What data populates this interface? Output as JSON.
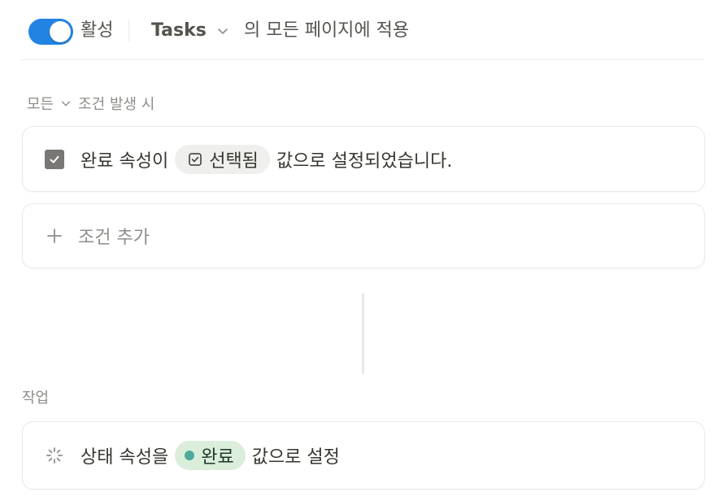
{
  "header": {
    "toggle_on": true,
    "active_label": "활성",
    "database_name": "Tasks",
    "apply_text": "의 모든 페이지에 적용"
  },
  "trigger": {
    "mode": "모든",
    "label_suffix": "조건 발생 시",
    "condition": {
      "prefix": "완료 속성이",
      "value_pill": "선택됨",
      "suffix": "값으로 설정되었습니다."
    },
    "add_condition_label": "조건 추가"
  },
  "actions": {
    "section_label": "작업",
    "items": [
      {
        "prefix": "상태 속성을",
        "value_pill": "완료",
        "suffix": "값으로 설정"
      }
    ]
  },
  "colors": {
    "accent": "#2383e2",
    "status_done_bg": "#dbeddb",
    "status_done_dot": "#4dab9a"
  },
  "icons": {
    "checkbox": "checkbox-checked-icon",
    "checked_value": "checked-square-icon",
    "add": "plus-icon",
    "action": "spinner-icon",
    "dropdown": "chevron-down-icon"
  }
}
